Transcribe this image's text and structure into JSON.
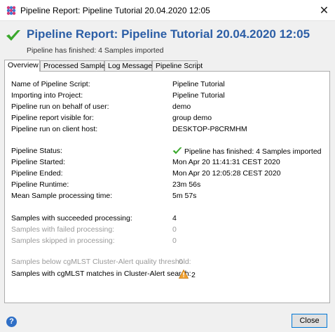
{
  "window": {
    "title": "Pipeline Report: Pipeline Tutorial 20.04.2020 12:05",
    "close_glyph": "✕"
  },
  "header": {
    "title": "Pipeline Report: Pipeline Tutorial 20.04.2020 12:05",
    "subtitle": "Pipeline has finished: 4 Samples imported",
    "status_icon": "check-icon",
    "accent_color": "#2c5ea6"
  },
  "tabs": [
    {
      "label": "Overview",
      "active": true
    },
    {
      "label": "Processed Samples",
      "active": false
    },
    {
      "label": "Log Messages",
      "active": false
    },
    {
      "label": "Pipeline Script",
      "active": false
    }
  ],
  "overview": {
    "name_of_script": {
      "label": "Name of Pipeline Script:",
      "value": "Pipeline Tutorial"
    },
    "importing_into": {
      "label": "Importing into Project:",
      "value": "Pipeline Tutorial"
    },
    "run_on_behalf": {
      "label": "Pipeline run on behalf of user:",
      "value": "demo"
    },
    "visible_for": {
      "label": "Pipeline report visible for:",
      "value": "group demo"
    },
    "client_host": {
      "label": "Pipeline run on client host:",
      "value": "DESKTOP-P8CRMHM"
    },
    "status": {
      "label": "Pipeline Status:",
      "value": "Pipeline has finished: 4 Samples imported"
    },
    "started": {
      "label": "Pipeline Started:",
      "value": "Mon Apr 20 11:41:31 CEST 2020"
    },
    "ended": {
      "label": "Pipeline Ended:",
      "value": "Mon Apr 20 12:05:28 CEST 2020"
    },
    "runtime": {
      "label": "Pipeline Runtime:",
      "value": "23m 56s"
    },
    "mean_time": {
      "label": "Mean Sample processing time:",
      "value": "5m 57s"
    },
    "succeeded": {
      "label": "Samples with succeeded processing:",
      "value": "4"
    },
    "failed": {
      "label": "Samples with failed processing:",
      "value": "0"
    },
    "skipped": {
      "label": "Samples skipped in processing:",
      "value": "0"
    },
    "below_threshold": {
      "label": "Samples below cgMLST Cluster-Alert quality threshold:",
      "value": "0"
    },
    "cluster_matches": {
      "label": "Samples with cgMLST matches in Cluster-Alert search:",
      "value": "2"
    }
  },
  "footer": {
    "help_glyph": "?",
    "close_label": "Close"
  }
}
